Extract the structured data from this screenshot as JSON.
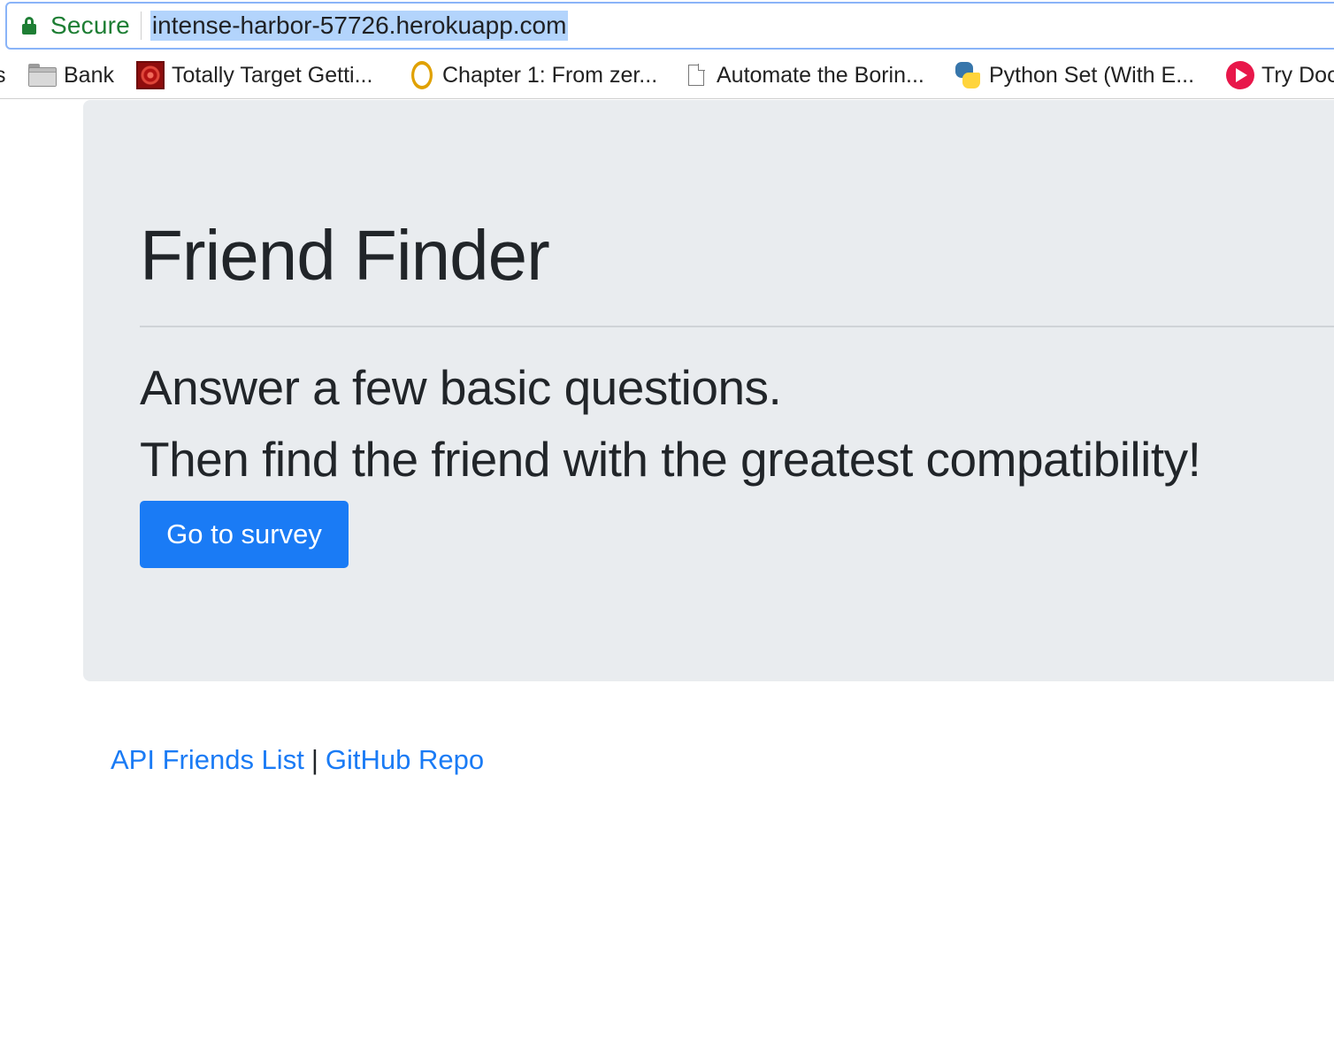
{
  "browser": {
    "security_label": "Secure",
    "url": "intense-harbor-57726.herokuapp.com",
    "bookmarks": [
      {
        "label": "s",
        "icon": "truncated"
      },
      {
        "label": "Bank",
        "icon": "folder-icon"
      },
      {
        "label": "Totally Target Getti...",
        "icon": "target-favicon-icon"
      },
      {
        "label": "Chapter 1: From zer...",
        "icon": "oreilly-favicon-icon"
      },
      {
        "label": "Automate the Borin...",
        "icon": "document-icon"
      },
      {
        "label": "Python Set (With E...",
        "icon": "python-favicon-icon"
      },
      {
        "label": "Try Doc",
        "icon": "play-favicon-icon"
      }
    ]
  },
  "jumbotron": {
    "title": "Friend Finder",
    "lead_line_1": "Answer a few basic questions.",
    "lead_line_2": "Then find the friend with the greatest compatibility!",
    "button_label": "Go to survey"
  },
  "footer": {
    "api_link_label": "API Friends List",
    "separator": "|",
    "github_link_label": "GitHub Repo"
  },
  "colors": {
    "primary": "#1a7bf5",
    "jumbotron_bg": "#e9ecef",
    "secure_green": "#1e7e34",
    "text": "#212529"
  }
}
